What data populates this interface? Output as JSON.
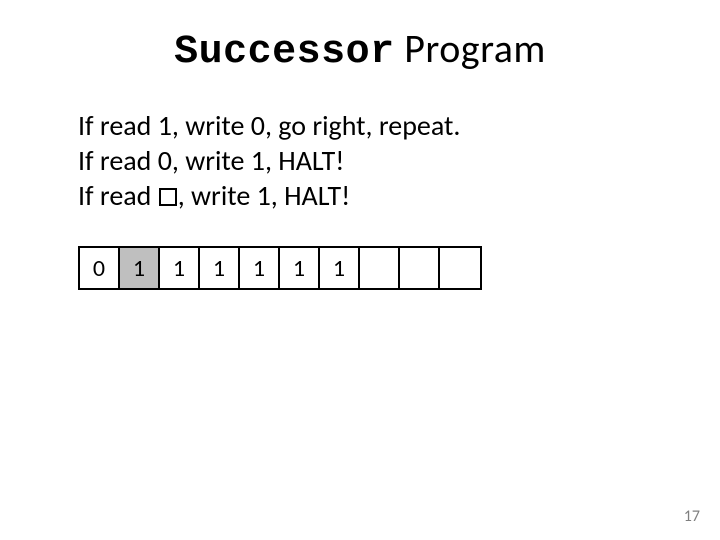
{
  "title": {
    "mono": "Successor",
    "rest": " Program"
  },
  "rules": {
    "line1a": "If read 1, write 0, go right, repeat.",
    "line2a": "If read 0, write 1, HALT!",
    "line3a": "If read ",
    "line3b": ", write 1, HALT!"
  },
  "tape": {
    "head_index": 1,
    "cells": [
      "0",
      "1",
      "1",
      "1",
      "1",
      "1",
      "1",
      "",
      "",
      ""
    ]
  },
  "page_number": "17"
}
